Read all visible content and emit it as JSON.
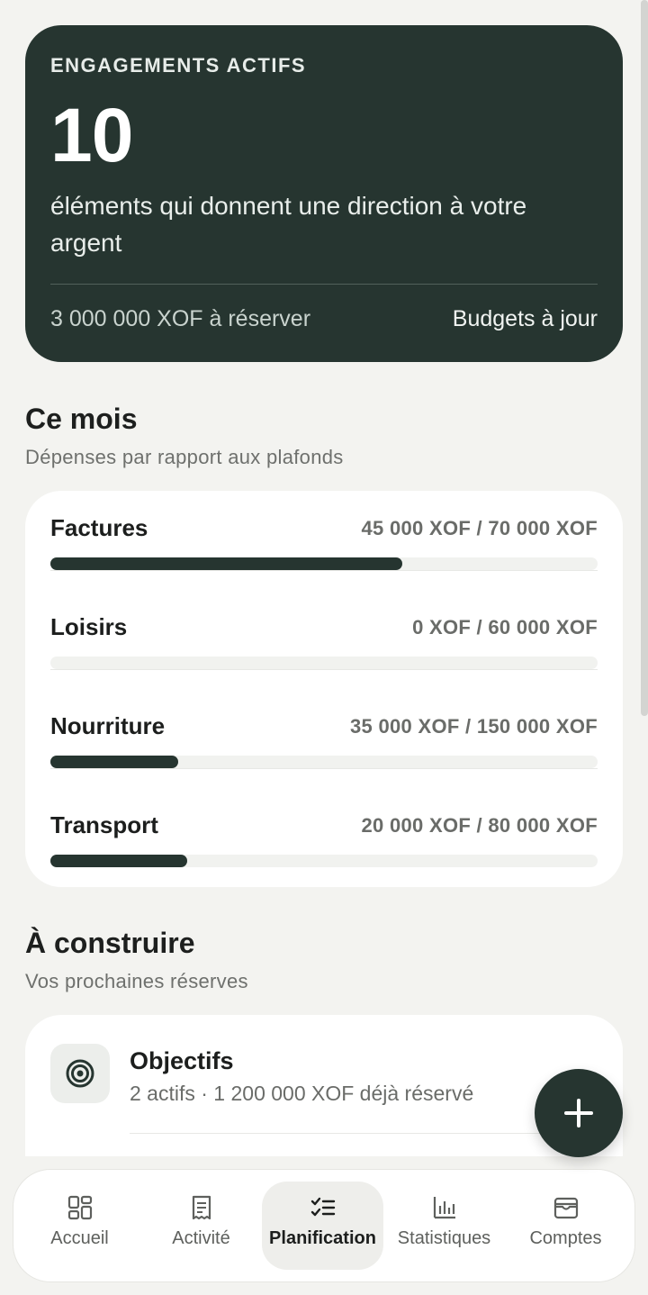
{
  "hero": {
    "eyebrow": "ENGAGEMENTS ACTIFS",
    "count": "10",
    "description": "éléments qui donnent une direction à votre argent",
    "to_reserve": "3 000 000 XOF à réserver",
    "status": "Budgets à jour"
  },
  "this_month": {
    "title": "Ce mois",
    "subtitle": "Dépenses par rapport aux plafonds",
    "budgets": [
      {
        "name": "Factures",
        "amount": "45 000 XOF / 70 000 XOF",
        "progress": 0.643
      },
      {
        "name": "Loisirs",
        "amount": "0 XOF / 60 000 XOF",
        "progress": 0.0
      },
      {
        "name": "Nourriture",
        "amount": "35 000 XOF / 150 000 XOF",
        "progress": 0.233
      },
      {
        "name": "Transport",
        "amount": "20 000 XOF / 80 000 XOF",
        "progress": 0.25
      }
    ]
  },
  "to_build": {
    "title": "À construire",
    "subtitle": "Vos prochaines réserves",
    "items": [
      {
        "title": "Objectifs",
        "meta": "2 actifs · 1 200 000 XOF déjà réservé",
        "icon": "target-icon"
      }
    ]
  },
  "fab": {
    "icon": "plus-icon"
  },
  "nav": {
    "items": [
      {
        "label": "Accueil",
        "icon": "grid-icon",
        "active": false
      },
      {
        "label": "Activité",
        "icon": "receipt-icon",
        "active": false
      },
      {
        "label": "Planification",
        "icon": "checklist-icon",
        "active": true
      },
      {
        "label": "Statistiques",
        "icon": "bar-chart-icon",
        "active": false
      },
      {
        "label": "Comptes",
        "icon": "wallet-icon",
        "active": false
      }
    ]
  },
  "colors": {
    "primary": "#263530",
    "background": "#f3f3f0",
    "card": "#ffffff"
  }
}
